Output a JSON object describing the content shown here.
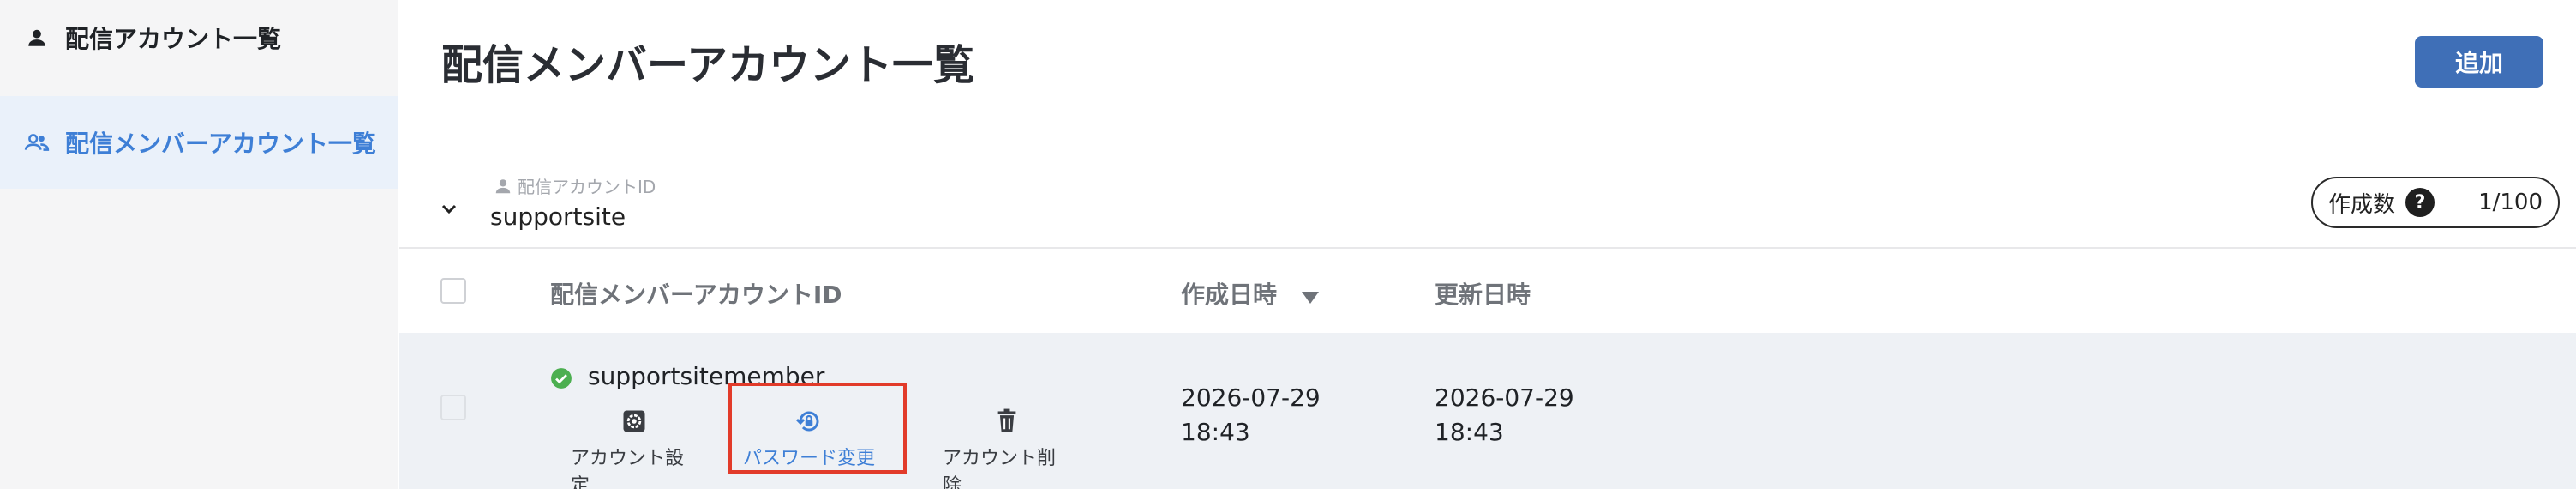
{
  "sidebar": {
    "items": [
      {
        "label": "配信アカウント一覧",
        "icon": "person-icon",
        "active": false
      },
      {
        "label": "配信メンバーアカウント一覧",
        "icon": "people-icon",
        "active": true
      }
    ]
  },
  "header": {
    "title": "配信メンバーアカウント一覧",
    "add_label": "追加"
  },
  "account": {
    "label": "配信アカウントID",
    "value": "supportsite",
    "count_label": "作成数",
    "help": "?",
    "count": "1/100"
  },
  "table": {
    "columns": [
      "配信メンバーアカウントID",
      "作成日時",
      "更新日時"
    ],
    "rows": [
      {
        "member_id": "supportsitemember",
        "status": "active",
        "created_date": "2026-07-29",
        "created_time": "18:43",
        "updated_date": "2026-07-29",
        "updated_time": "18:43",
        "actions": [
          "アカウント設定",
          "パスワード変更",
          "アカウント削除"
        ]
      }
    ]
  },
  "colors": {
    "accent": "#3e7fd6",
    "button": "#3f6fb7",
    "highlight": "#e23b2a",
    "success": "#4caf50"
  }
}
